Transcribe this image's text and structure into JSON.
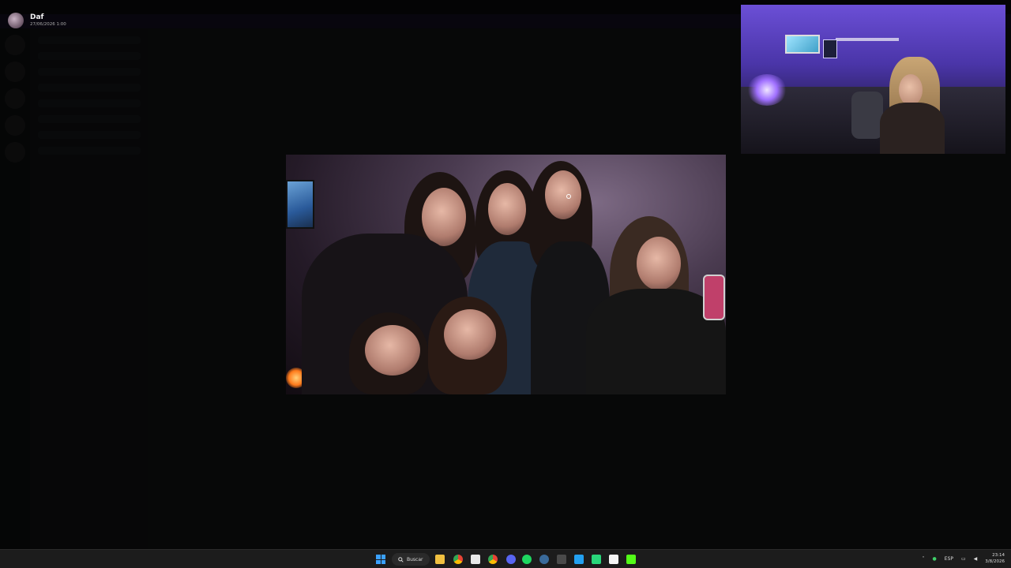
{
  "viewer": {
    "user_name": "Daf",
    "date": "27/06/2026 1:00"
  },
  "taskbar": {
    "search_label": "Buscar",
    "language": "ESP",
    "time": "23:14",
    "date": "3/8/2026",
    "apps": [
      "file-explorer-icon",
      "chrome-icon",
      "epic-games-icon",
      "chrome-alt-icon",
      "discord-icon",
      "spotify-icon",
      "steam-icon",
      "calculator-icon",
      "vscode-icon",
      "twitch-studio-icon",
      "notion-icon",
      "kick-icon"
    ]
  },
  "colors": {
    "accent": "#3aa0ff",
    "banner": "#3c2a6e",
    "webcam_light": "#6b4fd6"
  }
}
